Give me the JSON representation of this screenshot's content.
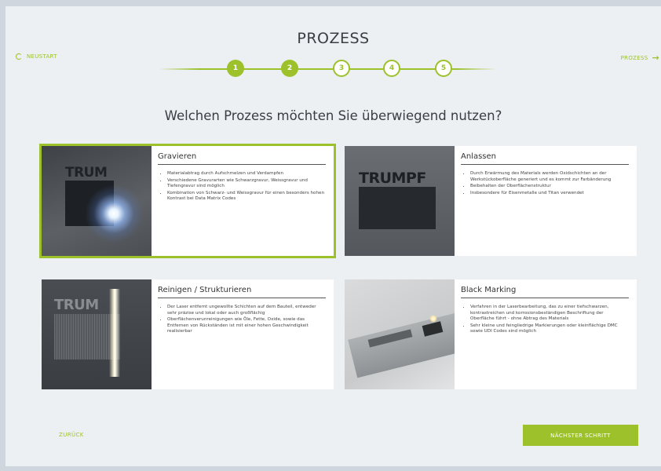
{
  "header": {
    "restart_label": "NEUSTART",
    "title": "PROZESS",
    "right_label": "PROZESS"
  },
  "stepper": {
    "steps": [
      "1",
      "2",
      "3",
      "4",
      "5"
    ],
    "completed": 2,
    "accent": "#9cc12a"
  },
  "question": "Welchen Prozess möchten Sie überwiegend nutzen?",
  "cards": [
    {
      "title": "Gravieren",
      "image_text": "TRUM",
      "selected": true,
      "bullets": [
        "Materialabtrag durch Aufschmelzen und Verdampfen",
        "Verschiedene Gravurarten wie Schwarzgravur, Weissgravur und Tiefengravur sind möglich",
        "Kombination von Schwarz- und Weissgravur für einen besonders hohen Kontrast bei Data Matrix Codes"
      ]
    },
    {
      "title": "Anlassen",
      "image_text": "TRUMPF",
      "selected": false,
      "bullets": [
        "Durch Erwärmung des Materials werden Oxidschichten an der Werkstückoberfläche generiert und es kommt zur Farbänderung",
        "Beibehalten der Oberflächenstruktur",
        "Insbesondere für Eisenmetalle und Titan verwendet"
      ]
    },
    {
      "title": "Reinigen / Strukturieren",
      "image_text": "TRUM",
      "selected": false,
      "bullets": [
        "Der Laser entfernt ungewollte Schichten auf dem Bauteil, entweder sehr präzise und lokal oder auch großflächig",
        "Oberflächenverunreinigungen wie Öle, Fette, Oxide, sowie das Entfernen von Rückständen ist mit einer hohen Geschwindigkeit realisierbar"
      ]
    },
    {
      "title": "Black Marking",
      "image_text": "",
      "selected": false,
      "bullets": [
        "Verfahren in der Laserbearbeitung, das zu einer tiefschwarzen, kontrastreichen und korrosionsbeständigen Beschriftung der Oberfläche führt - ohne Abtrag des Materials",
        "Sehr kleine und feingliedrige Markierungen oder kleinflächige DMC sowie UDI Codes sind möglich"
      ]
    }
  ],
  "footer": {
    "back_label": "ZURÜCK",
    "next_label": "NÄCHSTER SCHRITT"
  }
}
